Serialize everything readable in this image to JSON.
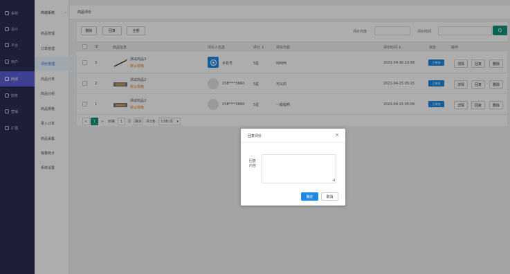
{
  "nav": {
    "items": [
      {
        "label": "系统",
        "icon": "gear-icon"
      },
      {
        "label": "设计",
        "icon": "design-icon"
      },
      {
        "label": "平台",
        "icon": "platform-icon"
      },
      {
        "label": "用户",
        "icon": "user-icon"
      },
      {
        "label": "商城",
        "icon": "shop-icon",
        "active": true
      },
      {
        "label": "财务",
        "icon": "finance-icon"
      },
      {
        "label": "营销",
        "icon": "marketing-icon"
      },
      {
        "label": "扩展",
        "icon": "extend-icon"
      }
    ]
  },
  "subnav": {
    "header": "商城系统",
    "items": [
      {
        "label": "商品管理"
      },
      {
        "label": "订单管理"
      },
      {
        "label": "评价管理",
        "active": true
      },
      {
        "label": "商品分类"
      },
      {
        "label": "商品分组"
      },
      {
        "label": "商品規格"
      },
      {
        "label": "录入订单"
      },
      {
        "label": "商品采集"
      },
      {
        "label": "销量统计"
      },
      {
        "label": "系统设置"
      }
    ]
  },
  "tab": {
    "label": "商品评价"
  },
  "toolbar": {
    "delete_label": "删除",
    "reply_label": "回复",
    "all_label": "全部",
    "filter_content_label": "评价内容",
    "filter_time_label": "评价时间",
    "search_icon": "Q"
  },
  "table": {
    "headers": {
      "id": "ID",
      "product": "商品信息",
      "reviewer": "评价人信息",
      "rating": "评分 ⇕",
      "content": "评价内容",
      "time": "评价时间 ⇕",
      "status": "状态",
      "actions": "操作"
    },
    "rows": [
      {
        "id": "3",
        "name": "测试商品3",
        "tag": "默认规格",
        "reviewer": "手机号",
        "rating": "5星",
        "content": "呵呵呵",
        "time": "2021-04-16 22:58",
        "status": "已审核",
        "avatar": "logo"
      },
      {
        "id": "2",
        "name": "测试商品2",
        "tag": "默认规格",
        "reviewer": "158****3660",
        "rating": "5星",
        "content": "可以的",
        "time": "2021-04-15 05:15",
        "status": "已审核",
        "avatar": "grey"
      },
      {
        "id": "1",
        "name": "测试商品2",
        "tag": "默认规格",
        "reviewer": "158****3660",
        "rating": "5星",
        "content": "一般般啊",
        "time": "2021-04-15 05:09",
        "status": "已审核",
        "avatar": "grey"
      }
    ],
    "actions": {
      "detail": "详情",
      "reply": "回复",
      "delete": "删除"
    }
  },
  "pager": {
    "prev": "<",
    "current": "1",
    "next": ">",
    "goto_label": "到第",
    "page_input": "1",
    "page_unit": "页",
    "confirm": "确定",
    "total": "共3条",
    "per_page": "10条/页"
  },
  "dialog": {
    "title": "回复评价",
    "close": "×",
    "label": "回复内容",
    "ok": "确定",
    "cancel": "取消"
  },
  "colors": {
    "nav_bg": "#2b2d52",
    "nav_active": "#5a5fd6",
    "primary": "#1e88e5",
    "green": "#14937a"
  }
}
